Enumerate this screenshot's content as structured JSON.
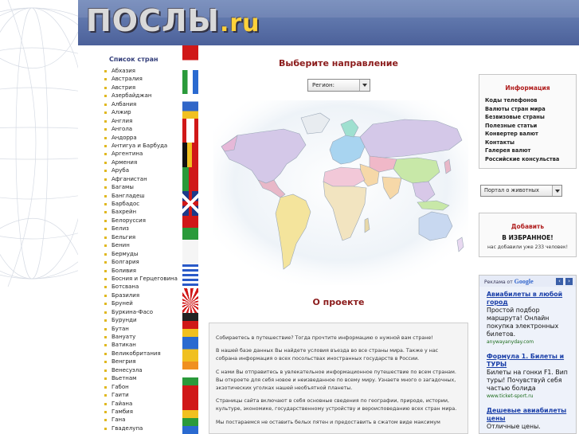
{
  "header": {
    "logo_main": "ПОСЛЫ",
    "logo_ext": ".ru"
  },
  "countries": {
    "title": "Список стран",
    "items": [
      "Абхазия",
      "Австралия",
      "Австрия",
      "Азербайджан",
      "Албания",
      "Алжир",
      "Англия",
      "Ангола",
      "Андорра",
      "Антигуа и Барбуда",
      "Аргентина",
      "Армения",
      "Аруба",
      "Афганистан",
      "Багамы",
      "Бангладеш",
      "Барбадос",
      "Бахрейн",
      "Белоруссия",
      "Белиз",
      "Бельгия",
      "Бенин",
      "Бермуды",
      "Болгария",
      "Боливия",
      "Босния и Герцеговина",
      "Ботсвана",
      "Бразилия",
      "Бруней",
      "Буркина-Фасо",
      "Бурунди",
      "Бутан",
      "Вануату",
      "Ватикан",
      "Великобритания",
      "Венгрия",
      "Венесуэла",
      "Вьетнам",
      "Габон",
      "Гаити",
      "Гайана",
      "Гамбия",
      "Гана",
      "Гваделупа"
    ]
  },
  "main": {
    "title": "Выберите направление",
    "region_select": "Регион:",
    "about_title": "О проекте",
    "about_paragraphs": [
      "Собираетесь в путешествие? Тогда прочтите информацию о нужной вам стране!",
      "В нашей базе данных Вы найдете условия въезда во все страны мира. Также у нас собрана информация о всех посольствах иностранных государств в России.",
      "С нами Вы отправитесь в увлекательное информационное путешествие по всем странам. Вы откроете для себя новое и неизведанное по всему миру. Узнаете много о загадочных, экзотических уголках нашей необъятной планеты.",
      "Страницы сайта включают в себя основные сведения по географии, природе, истории, культуре, экономике, государственному устройству и вероисповеданию всех стран мира.",
      "Мы постараемся не оставить белых пятен и предоставить в сжатом виде максимум"
    ]
  },
  "info": {
    "title": "Информация",
    "links": [
      "Коды телефонов",
      "Валюты стран мира",
      "Безвизовые страны",
      "Полезные статьи",
      "Конвертер валют",
      "Контакты",
      "Галерея валют",
      "Российские консульства"
    ]
  },
  "portal_select": "Портал о животных",
  "favorites": {
    "add": "Добавить",
    "in": "В ИЗБРАННОЕ!",
    "count": "нас добавили уже 233 человек!"
  },
  "ads": {
    "label": "Реклама от",
    "brand": "Google",
    "items": [
      {
        "title": "Авиабилеты в любой город",
        "desc": "Простой подбор маршрута! Онлайн покупка электронных билетов.",
        "url": "anywayanyday.com"
      },
      {
        "title": "Формула 1. Билеты и ТУРЫ",
        "desc": "Билеты на гонки F1. Вип туры! Почувствуй себя частью болида",
        "url": "www.ticket-sport.ru"
      },
      {
        "title": "Дешевые авиабилеты цены",
        "desc": "Отличные цены."
      }
    ]
  },
  "colors": {
    "header": "#5b72a8",
    "section_title": "#8b1b1b",
    "info_title": "#b01e1e",
    "ad_link": "#1a3fa8",
    "ad_url": "#1a6b1a",
    "bullet": "#e0b820"
  }
}
